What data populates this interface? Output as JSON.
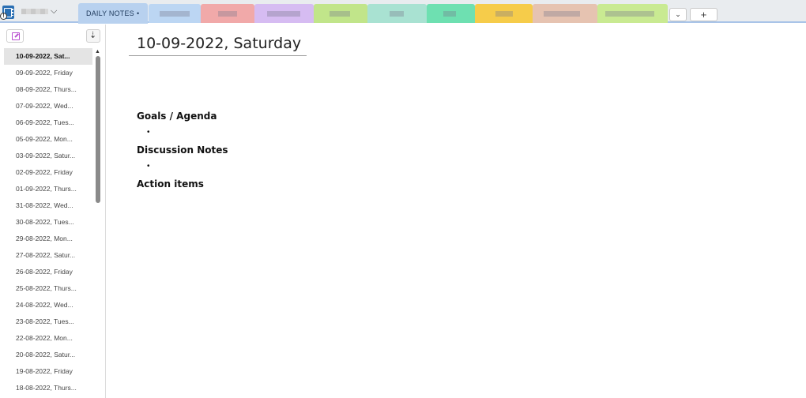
{
  "header": {
    "tabs": [
      {
        "label": "DAILY NOTES",
        "active": true,
        "color": "#b8d1ef"
      },
      {
        "label": "",
        "color": "#bcd6f3"
      },
      {
        "label": "",
        "color": "#f1a9a9"
      },
      {
        "label": "",
        "color": "#d6bcf2"
      },
      {
        "label": "",
        "color": "#c1e58a"
      },
      {
        "label": "",
        "color": "#a9e2d2"
      },
      {
        "label": "",
        "color": "#6ee0b1"
      },
      {
        "label": "",
        "color": "#f6cc4a"
      },
      {
        "label": "",
        "color": "#e6c3b1"
      },
      {
        "label": "",
        "color": "#c9ea92"
      }
    ],
    "active_tab_marker": "•",
    "dropdown_glyph": "⌄",
    "add_glyph": "+"
  },
  "sidebar": {
    "pages": [
      "10-09-2022, Sat...",
      "09-09-2022, Friday",
      "08-09-2022, Thurs...",
      "07-09-2022, Wed...",
      "06-09-2022, Tues...",
      "05-09-2022, Mon...",
      "03-09-2022, Satur...",
      "02-09-2022, Friday",
      "01-09-2022, Thurs...",
      "31-08-2022, Wed...",
      "30-08-2022, Tues...",
      "29-08-2022, Mon...",
      "27-08-2022, Satur...",
      "26-08-2022, Friday",
      "25-08-2022, Thurs...",
      "24-08-2022, Wed...",
      "23-08-2022, Tues...",
      "22-08-2022, Mon...",
      "20-08-2022, Satur...",
      "19-08-2022, Friday",
      "18-08-2022, Thurs..."
    ],
    "selected_index": 0
  },
  "page": {
    "title": "10-09-2022, Saturday",
    "headings": [
      "Goals / Agenda",
      "Discussion Notes",
      "Action items"
    ],
    "bullet_glyph": "•"
  }
}
